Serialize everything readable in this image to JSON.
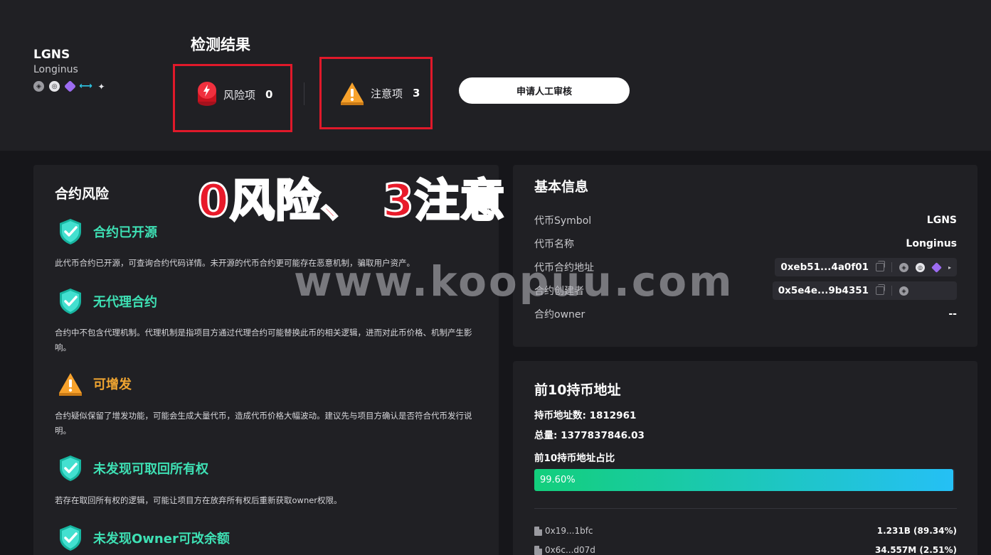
{
  "token": {
    "symbol": "LGNS",
    "name": "Longinus",
    "chain_icons": [
      "polygon-icon",
      "chain-icon-2",
      "gem-icon",
      "zksync-icon",
      "bear-icon"
    ]
  },
  "result": {
    "title": "检测结果",
    "risk_label": "风险项",
    "risk_count": "0",
    "warn_label": "注意项",
    "warn_count": "3",
    "review_button": "申请人工审核"
  },
  "overlay": {
    "annotation": "0风险、 3注意",
    "watermark": "www.koopuu.com"
  },
  "contract_risk": {
    "title": "合约风险",
    "items": [
      {
        "title": "合约已开源",
        "status": "safe",
        "desc": "此代币合约已开源，可查询合约代码详情。未开源的代币合约更可能存在恶意机制，骗取用户资产。"
      },
      {
        "title": "无代理合约",
        "status": "safe",
        "desc": "合约中不包含代理机制。代理机制是指项目方通过代理合约可能替换此币的相关逻辑，进而对此币价格、机制产生影响。"
      },
      {
        "title": "可增发",
        "status": "warning",
        "desc": "合约疑似保留了增发功能，可能会生成大量代币，造成代币价格大幅波动。建议先与项目方确认是否符合代币发行说明。"
      },
      {
        "title": "未发现可取回所有权",
        "status": "safe",
        "desc": "若存在取回所有权的逻辑，可能让项目方在放弃所有权后重新获取owner权限。"
      },
      {
        "title": "未发现Owner可改余额",
        "status": "safe",
        "desc": ""
      }
    ]
  },
  "basic_info": {
    "title": "基本信息",
    "symbol_label": "代币Symbol",
    "symbol_value": "LGNS",
    "name_label": "代币名称",
    "name_value": "Longinus",
    "address_label": "代币合约地址",
    "address_value": "0xeb51...4a0f01",
    "creator_label": "合约创建者",
    "creator_value": "0x5e4e...9b4351",
    "owner_label": "合约owner",
    "owner_value": "--"
  },
  "top_holders": {
    "title": "前10持币地址",
    "holder_count_text": "持币地址数: 1812961",
    "total_text": "总量: 1377837846.03",
    "ratio_label": "前10持币地址占比",
    "ratio_text": "99.60%",
    "ratio_value": 0.996,
    "rows": [
      {
        "address": "0x19...1bfc",
        "amount": "1.231B",
        "percent": "(89.34%)"
      },
      {
        "address": "0x6c...d07d",
        "amount": "34.557M",
        "percent": "(2.51%)"
      }
    ]
  },
  "colors": {
    "accent_green": "#3ee0b4",
    "warning_orange": "#f0a531",
    "risk_red": "#e0192a",
    "progress_start": "#13cf7c",
    "progress_end": "#25c0f5"
  }
}
